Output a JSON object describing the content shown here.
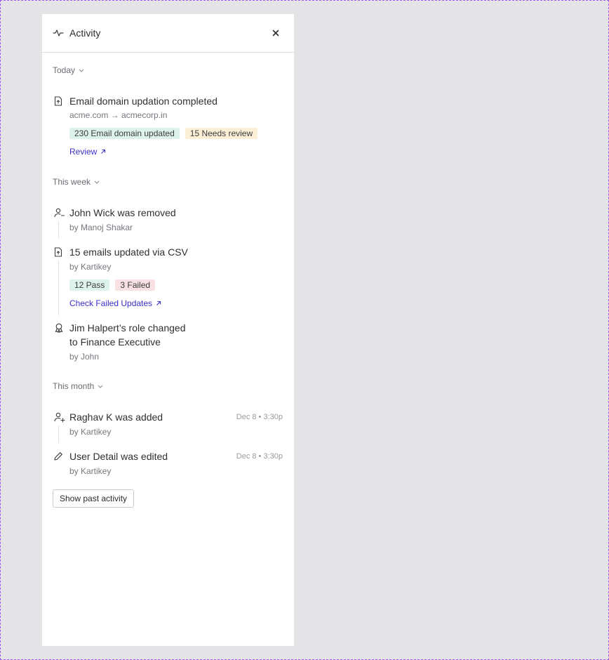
{
  "panel": {
    "title": "Activity",
    "icon": "activity-pulse-icon"
  },
  "sections": {
    "today": {
      "label": "Today",
      "items": [
        {
          "icon": "file-upload-icon",
          "title": "Email domain updation completed",
          "sub": "acme.com → acmecorp.in",
          "badges": [
            {
              "text": "230 Email domain updated",
              "color": "#ddf2ea"
            },
            {
              "text": "15 Needs review",
              "color": "#fbf0d5"
            }
          ],
          "link": "Review"
        }
      ]
    },
    "week": {
      "label": "This week",
      "items": [
        {
          "icon": "user-remove-icon",
          "title": "John Wick was removed",
          "sub": "by Manoj Shakar"
        },
        {
          "icon": "file-upload-icon",
          "title": "15 emails updated via CSV",
          "sub": "by Kartikey",
          "badges": [
            {
              "text": "12 Pass",
              "color": "#ddf2ea"
            },
            {
              "text": "3 Failed",
              "color": "#f9e1e3"
            }
          ],
          "link": "Check Failed Updates"
        },
        {
          "icon": "award-ribbon-icon",
          "title_line1": "Jim Halpert’s role changed",
          "title_line2": "to Finance Executive",
          "sub": "by John"
        }
      ]
    },
    "month": {
      "label": "This month",
      "items": [
        {
          "icon": "user-add-icon",
          "title": "Raghav K was added",
          "sub": "by Kartikey",
          "time": "Dec 8 • 3:30p"
        },
        {
          "icon": "pencil-icon",
          "title": "User Detail was edited",
          "sub": "by Kartikey",
          "time": "Dec 8 • 3:30p"
        }
      ]
    }
  },
  "footer": {
    "past_button": "Show past activity"
  },
  "colors": {
    "accent_link": "#3b2fc9",
    "frame_dash": "#9b5cf0",
    "backdrop": "#e4e4e6"
  }
}
